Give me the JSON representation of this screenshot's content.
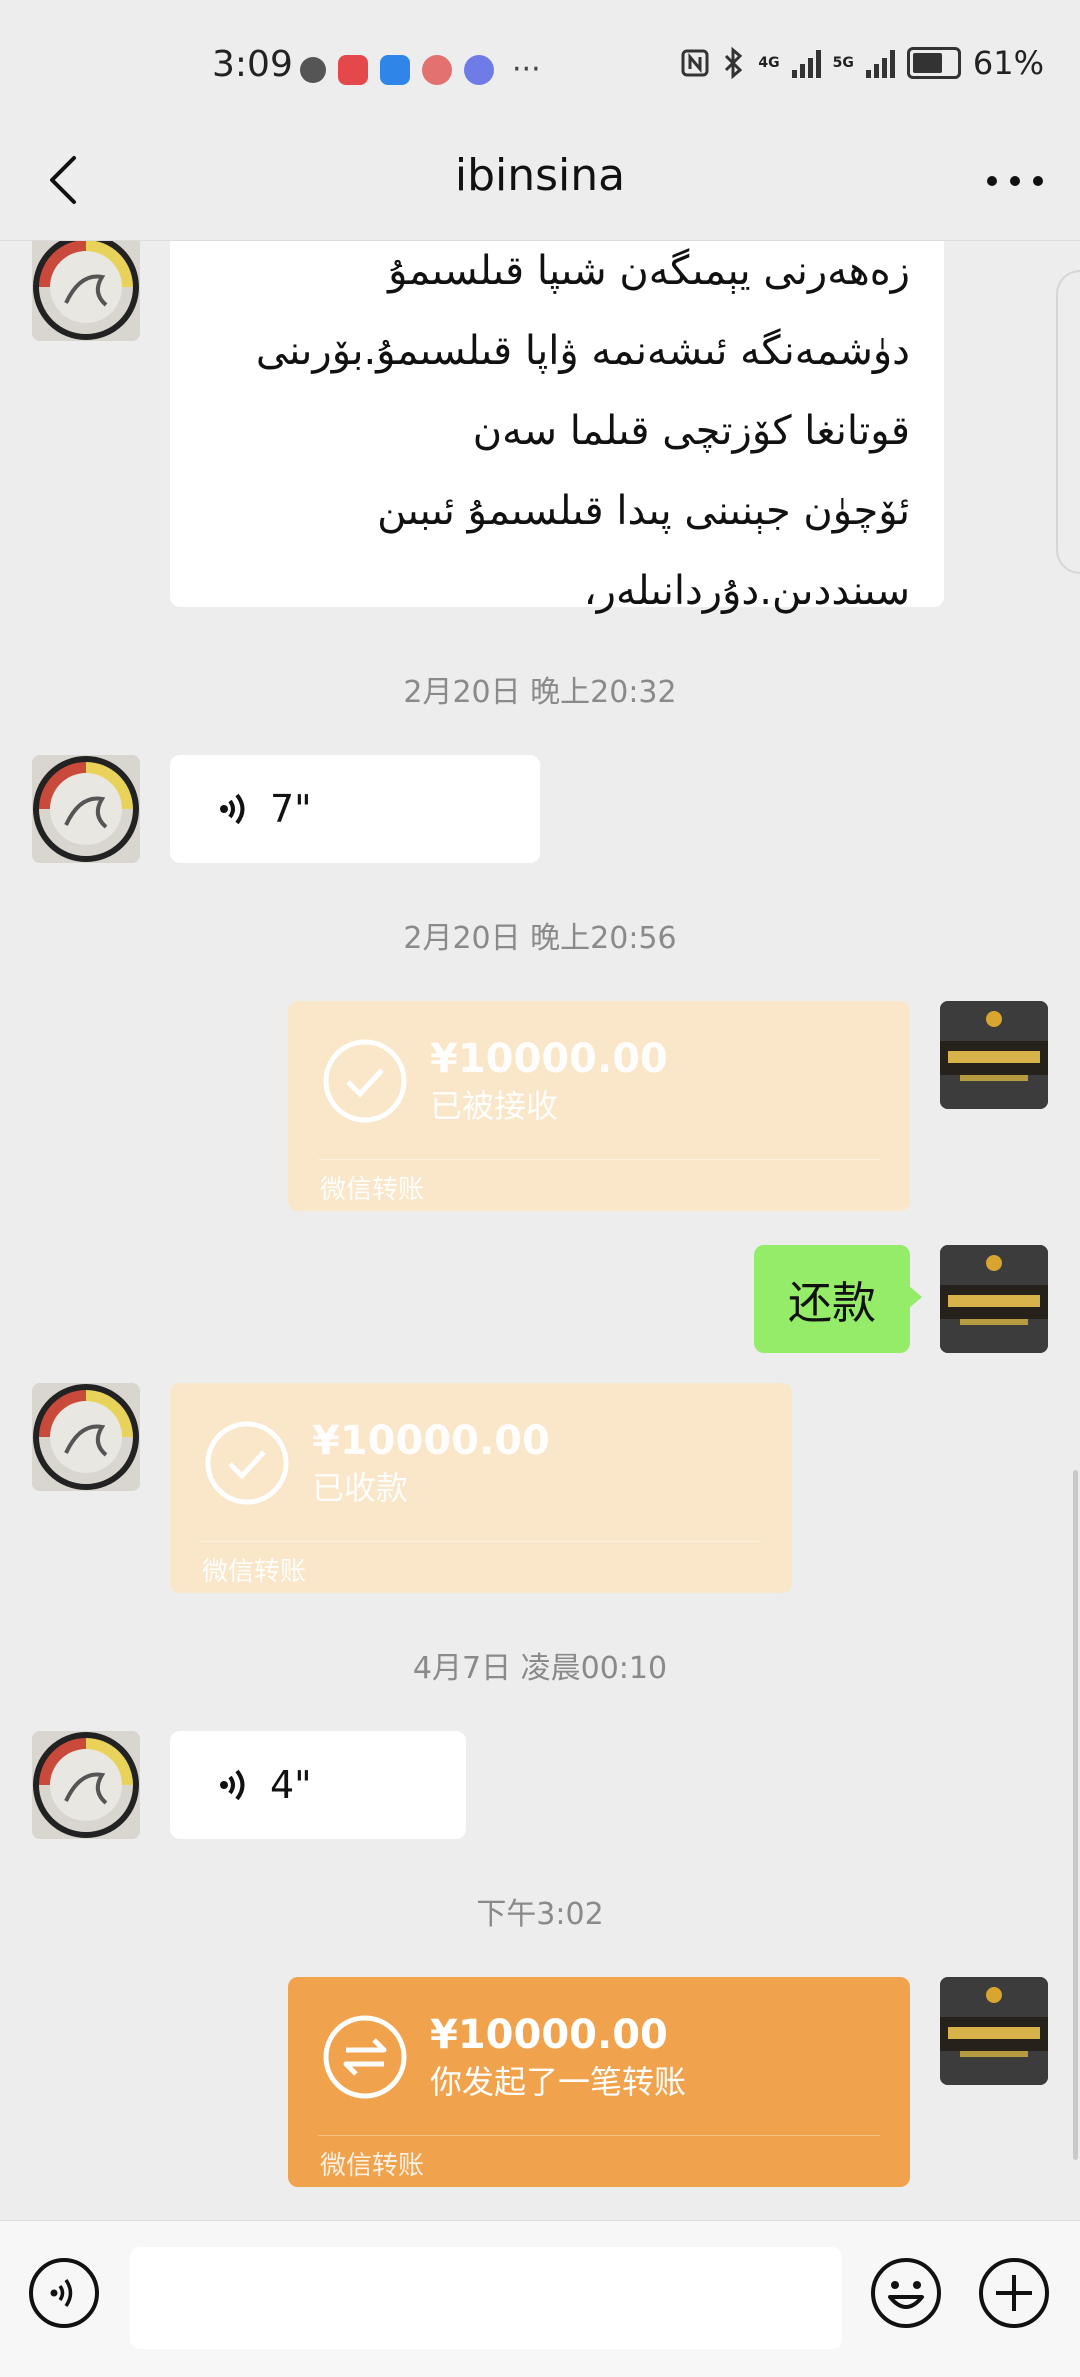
{
  "status": {
    "time": "3:09",
    "more": "···",
    "battery": "61%",
    "net1": "4G",
    "net2": "5G",
    "battery_level": 0.61
  },
  "header": {
    "title": "ibinsina"
  },
  "messages": {
    "text1": {
      "lines": [
        "زەھەرنى يېمىگەن شىپا قىلسىمۇ",
        "دۈشمەنگە ئىشەنمە ۋاپا قىلسىمۇ.بۆرىنى",
        "قوتانغا كۆزتچى قىلما سەن",
        "ئۆچۈن جېنىنى پىدا قىلسىمۇ ئىبىن",
        "سىنددىن.دۇردانىلەر،"
      ]
    },
    "ts1": "2月20日 晚上20:32",
    "voice1": "7\"",
    "ts2": "2月20日 晚上20:56",
    "transfer1": {
      "amount": "¥10000.00",
      "status": "已被接收",
      "footer": "微信转账"
    },
    "text2": "还款",
    "transfer2": {
      "amount": "¥10000.00",
      "status": "已收款",
      "footer": "微信转账"
    },
    "ts3": "4月7日 凌晨00:10",
    "voice2": "4\"",
    "ts4": "下午3:02",
    "transfer3": {
      "amount": "¥10000.00",
      "status": "你发起了一笔转账",
      "footer": "微信转账"
    }
  },
  "colors": {
    "transfer_active": "#f0a24c",
    "transfer_done": "#fae6c8",
    "bubble_green": "#95ec69",
    "background": "#ededed"
  },
  "icons": [
    "back-arrow-icon",
    "more-dots-icon",
    "voice-icon",
    "check-circle-icon",
    "transfer-arrows-icon",
    "voice-input-icon",
    "emoji-icon",
    "plus-icon"
  ]
}
